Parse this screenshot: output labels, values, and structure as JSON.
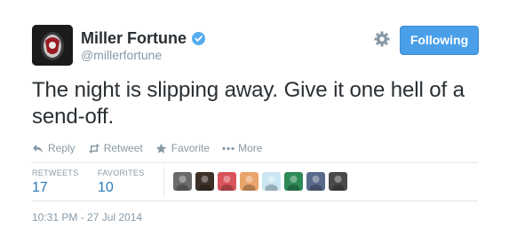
{
  "author": {
    "name": "Miller Fortune",
    "screen_name": "@millerfortune",
    "verified": true,
    "avatar_icon": "avatar-logo-icon"
  },
  "follow_button": {
    "label": "Following",
    "color": "#4a9fe8"
  },
  "tweet": {
    "text": "The night is slipping away. Give it one hell of a send-off."
  },
  "actions": [
    {
      "label": "Reply",
      "icon": "reply-icon"
    },
    {
      "label": "Retweet",
      "icon": "retweet-icon"
    },
    {
      "label": "Favorite",
      "icon": "star-icon"
    },
    {
      "label": "More",
      "icon": "more-dots-icon"
    }
  ],
  "stats": {
    "retweets_label": "RETWEETS",
    "retweets_value": "17",
    "favorites_label": "FAVORITES",
    "favorites_value": "10"
  },
  "facepile_colors": [
    "#6b6b6b",
    "#3d3027",
    "#d9535a",
    "#e8a46a",
    "#c9e6f2",
    "#2e8b57",
    "#596a8a",
    "#4a4a4a"
  ],
  "timestamp": "10:31 PM - 27 Jul 2014",
  "colors": {
    "link": "#2b7bb9",
    "muted": "#8899a6",
    "text": "#292f33",
    "verified": "#55acee"
  }
}
